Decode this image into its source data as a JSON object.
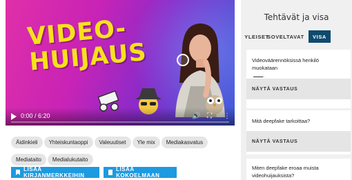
{
  "video": {
    "title_line1": "VIDEO-",
    "title_line2": "HUIJAUS",
    "time": "0:00 / 6:20",
    "progress": 0
  },
  "tags": [
    "Äidinkieli",
    "Yhteiskuntaoppi",
    "Valeuutiset",
    "Yle mix",
    "Mediakasvatus",
    "Mediataito",
    "Medialukutaito"
  ],
  "actions": {
    "bookmark_label": "LISÄÄ KIRJANMERKKEIHIN",
    "collection_label": "LISÄÄ KOKOELMAAN"
  },
  "panel": {
    "title": "Tehtävät ja visa",
    "tabs": {
      "yleiset": "YLEISET",
      "soveltavat": "SOVELTAVAT",
      "visa": "VISA"
    },
    "active_tab": "VISA",
    "questions": [
      {
        "text": "Videoväärennöksissä henkilö muokataan",
        "answer": "NÄYTÄ VASTAUS"
      },
      {
        "text": "Mitä deepfake tarkoittaa?",
        "answer": "NÄYTÄ VASTAUS"
      },
      {
        "text": "Miten deepfake eroaa muista videohuijauksista?"
      }
    ]
  },
  "colors": {
    "accent": "#1d9ae0",
    "active_tab": "#0e4a6e",
    "title_yellow": "#f7e11c"
  },
  "icons": [
    "play-icon",
    "volume-icon",
    "fullscreen-icon",
    "more-icon",
    "bookmark-icon",
    "collection-icon"
  ]
}
